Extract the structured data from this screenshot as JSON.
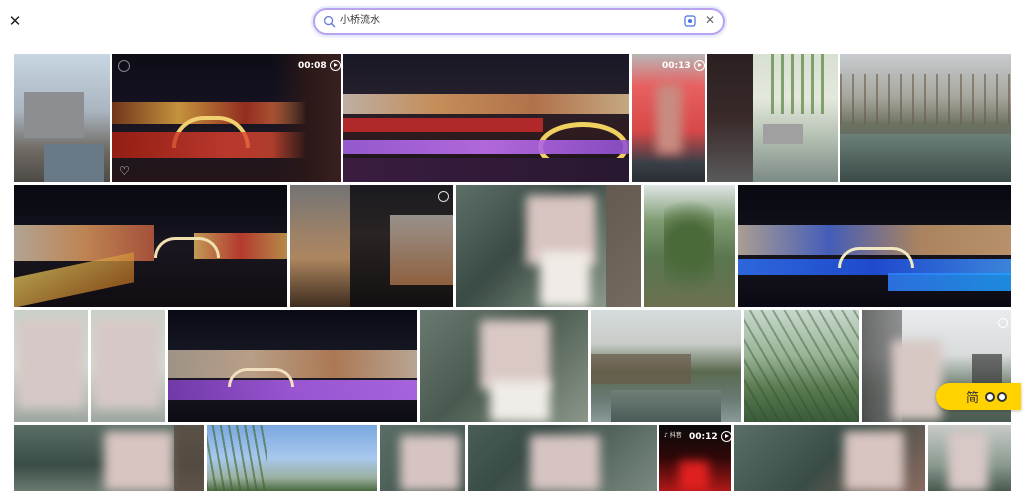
{
  "search": {
    "query": "小桥流水"
  },
  "badges": {
    "t1": "00:08",
    "t4": "00:13",
    "t21": "00:12"
  },
  "tiktok_label": "抖音",
  "fab": {
    "label": "简"
  },
  "colors": {
    "accent": "#b9a3f0",
    "fab": "#ffd200"
  }
}
